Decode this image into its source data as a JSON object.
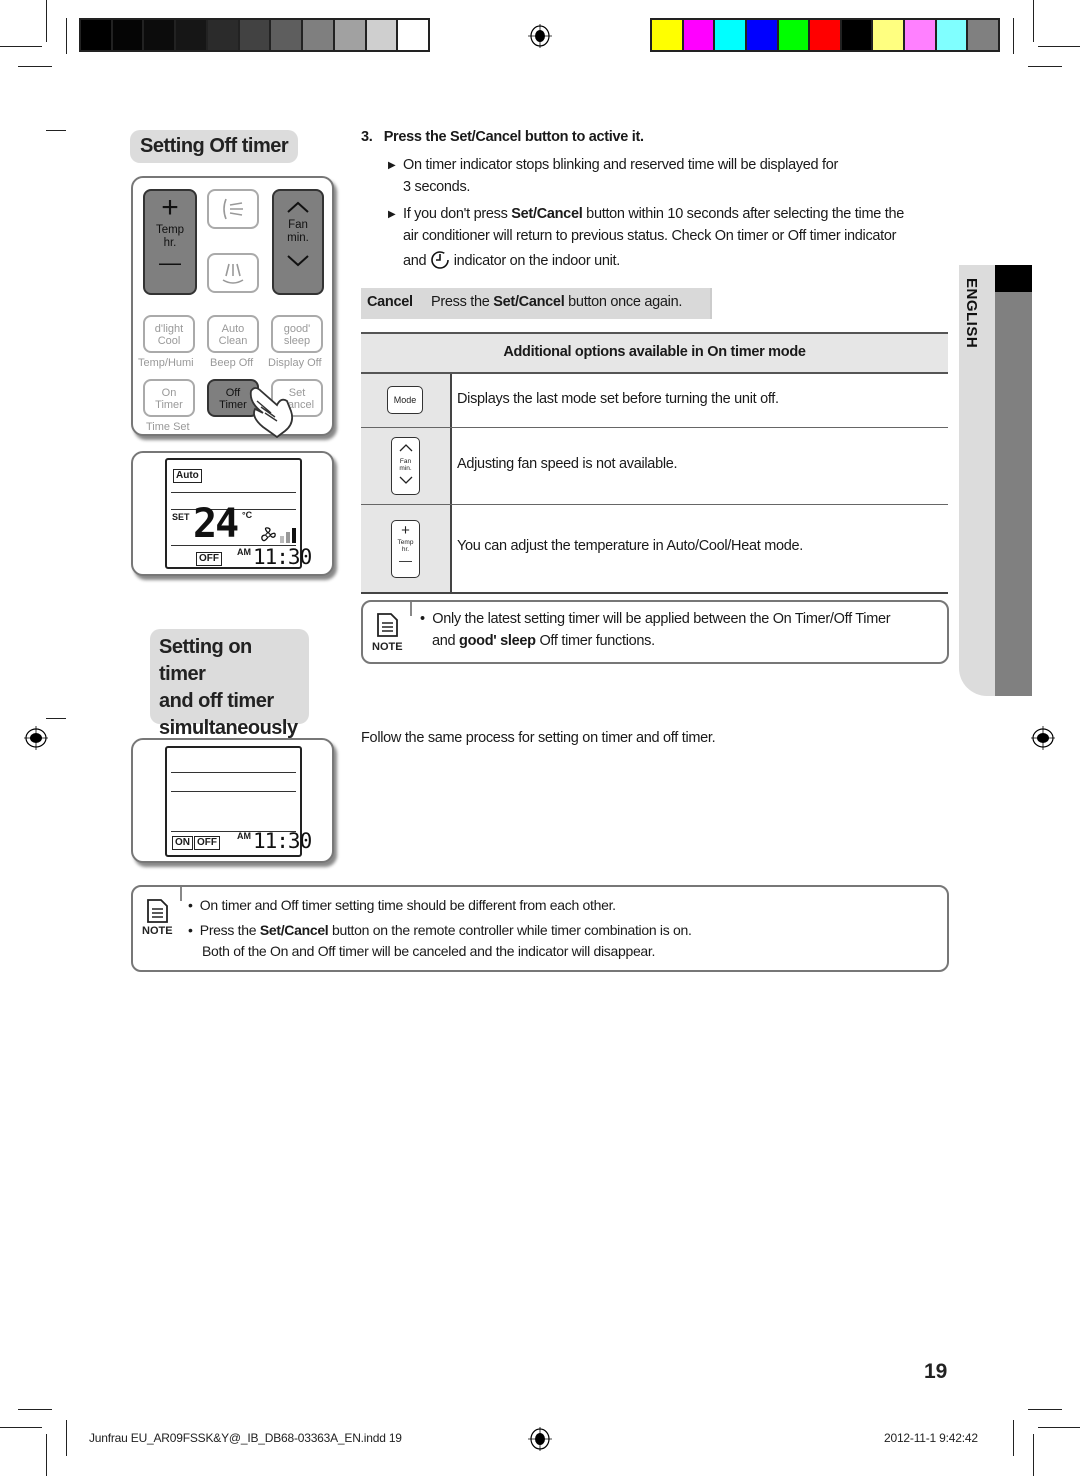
{
  "color_bars": {
    "grayscale": [
      "#000000",
      "#050505",
      "#0c0c0c",
      "#161616",
      "#2b2b2b",
      "#424242",
      "#5e5e5e",
      "#7f7f7f",
      "#a1a1a1",
      "#cfcfcf",
      "#ffffff"
    ],
    "colors": [
      "#ffff00",
      "#ff00ff",
      "#00ffff",
      "#0000ff",
      "#00ff00",
      "#ff0000",
      "#000000",
      "#ffff80",
      "#ff80ff",
      "#80ffff",
      "#808080"
    ]
  },
  "section1": {
    "title": "Setting Off timer",
    "remote": {
      "temp_plus": "+",
      "temp_label_1": "Temp",
      "temp_label_2": "hr.",
      "temp_minus": "—",
      "fan_label_1": "Fan",
      "fan_label_2": "min.",
      "btn_dlight_1": "d'light",
      "btn_dlight_2": "Cool",
      "btn_auto_1": "Auto",
      "btn_auto_2": "Clean",
      "btn_good_1": "good'",
      "btn_good_2": "sleep",
      "sub_temp_humi": "Temp/Humi",
      "sub_beep_off": "Beep Off",
      "sub_display_off": "Display Off",
      "btn_on_1": "On",
      "btn_on_2": "Timer",
      "btn_off_1": "Off",
      "btn_off_2": "Timer",
      "btn_set_1": "Set",
      "btn_set_2": "Cancel",
      "sub_time_set": "Time Set"
    },
    "display": {
      "mode": "Auto",
      "set_label": "SET",
      "temperature": "24",
      "unit": "°C",
      "timer_indicator": "OFF",
      "ampm": "AM",
      "time": "11:30"
    }
  },
  "step3": {
    "number": "3.",
    "heading_pre": "Press the ",
    "heading_bold": "Set/Cancel",
    "heading_post": " button to active it.",
    "bullet1_line1": "On timer indicator stops blinking and reserved time will be displayed for",
    "bullet1_line2": "3 seconds.",
    "bullet2_line1_pre": "If you don't press ",
    "bullet2_line1_bold": "Set/Cancel",
    "bullet2_line1_post": " button within 10 seconds after selecting the time the",
    "bullet2_line2": "air conditioner will return to previous status. Check On timer or Off timer indicator",
    "bullet2_line3_pre": "and",
    "bullet2_line3_post": "indicator on the indoor unit."
  },
  "cancel": {
    "label": "Cancel",
    "text_pre": "Press the ",
    "text_bold": "Set/Cancel",
    "text_post": " button once again."
  },
  "options_table": {
    "header": "Additional options available in On timer mode",
    "rows": [
      {
        "icon": "mode-button",
        "icon_label": "Mode",
        "text": "Displays the last mode set before turning the unit off."
      },
      {
        "icon": "fan-button",
        "icon_label_1": "Fan",
        "icon_label_2": "min.",
        "text": "Adjusting fan speed is not available."
      },
      {
        "icon": "temp-button",
        "icon_label_1": "Temp",
        "icon_label_2": "hr.",
        "text": "You can adjust the temperature in Auto/Cool/Heat mode."
      }
    ]
  },
  "note1": {
    "label": "NOTE",
    "line1": "Only the latest setting timer will be applied between the On Timer/Off Timer",
    "line2_pre": "and ",
    "line2_bold": "good' sleep",
    "line2_post": " Off timer functions."
  },
  "section2": {
    "title_line1": "Setting on timer",
    "title_line2": "and off timer",
    "title_line3": "simultaneously",
    "body": "Follow the same process for setting on timer and off timer.",
    "display": {
      "on_indicator": "ON",
      "off_indicator": "OFF",
      "ampm": "AM",
      "time": "11:30"
    }
  },
  "note2": {
    "label": "NOTE",
    "bullet1": "On timer and Off timer setting time should be different from each other.",
    "bullet2_pre": "Press the ",
    "bullet2_bold": "Set/Cancel",
    "bullet2_post": " button on the remote controller while timer combination is on.",
    "bullet2_line2": "Both of the On and Off timer will be canceled and the indicator will disappear."
  },
  "side_tab": {
    "language": "ENGLISH"
  },
  "page_number": "19",
  "footer": {
    "file": "Junfrau EU_AR09FSSK&Y@_IB_DB68-03363A_EN.indd   19",
    "timestamp": "2012-11-1   9:42:42"
  }
}
